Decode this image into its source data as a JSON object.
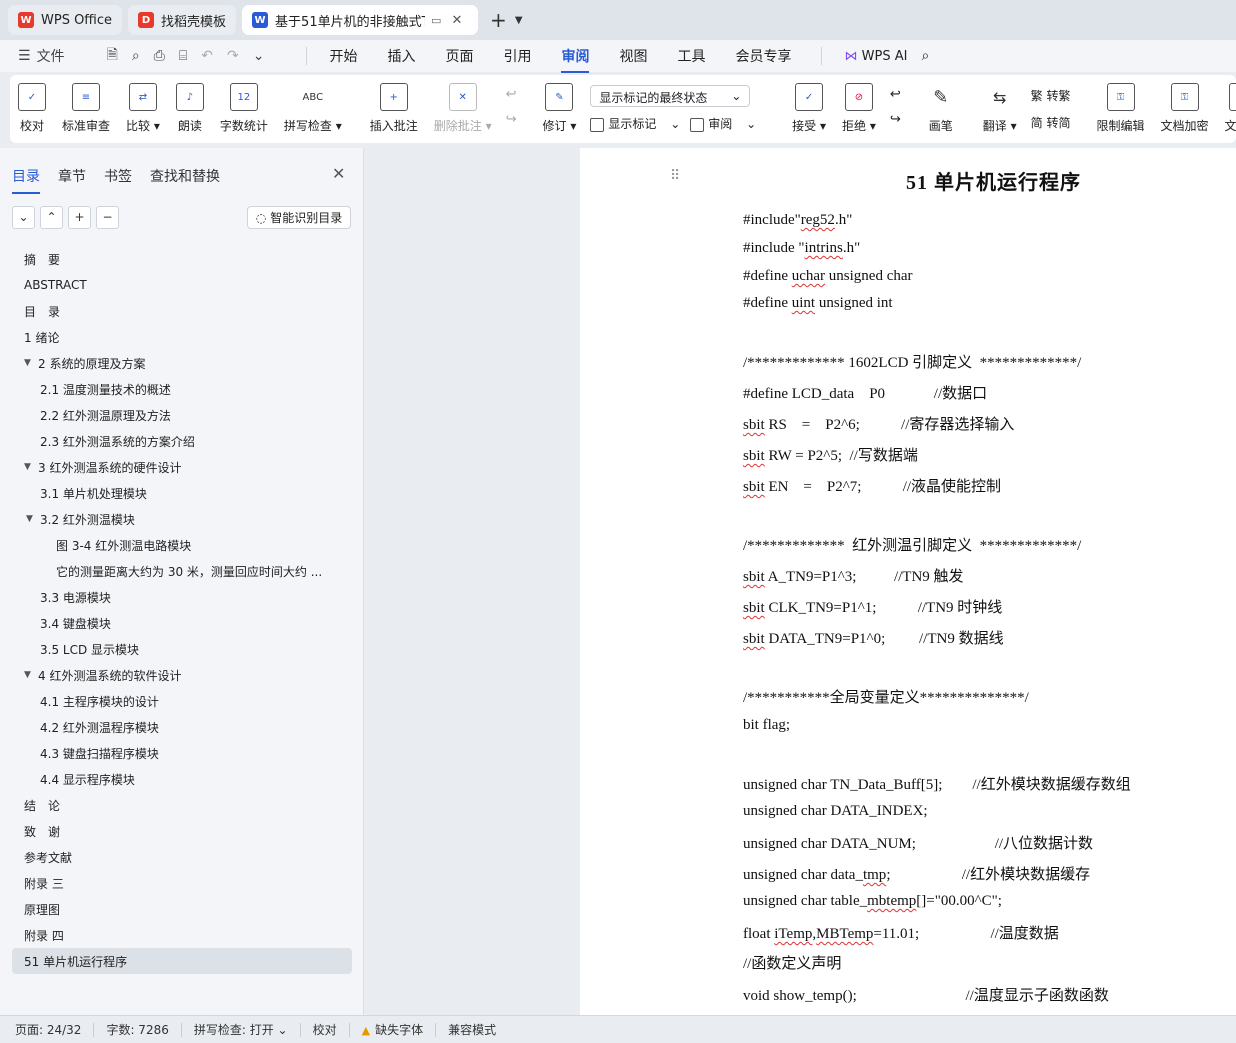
{
  "tabs": [
    {
      "label": "WPS Office",
      "logo": "W",
      "color": "#e8392d"
    },
    {
      "label": "找稻壳模板",
      "logo": "D",
      "color": "#e8392d"
    },
    {
      "label": "基于51单片机的非接触式TN9",
      "logo": "W",
      "color": "#2a5bd7"
    }
  ],
  "menu": {
    "file": "文件",
    "items": [
      "开始",
      "插入",
      "页面",
      "引用",
      "审阅",
      "视图",
      "工具",
      "会员专享"
    ],
    "active": "审阅",
    "wps_ai": "WPS AI"
  },
  "ribbon": {
    "proofread": "校对",
    "standard_review": "标准审查",
    "compare": "比较",
    "read_aloud": "朗读",
    "word_count": "字数统计",
    "spell_check": "拼写检查",
    "insert_comment": "插入批注",
    "delete_comment": "删除批注",
    "track_changes": "修订",
    "markup_dropdown": "显示标记的最终状态",
    "show_markup": "显示标记",
    "review": "审阅",
    "accept": "接受",
    "reject": "拒绝",
    "pen": "画笔",
    "translate": "翻译",
    "to_traditional": "转繁",
    "to_simplified": "转简",
    "restrict_edit": "限制编辑",
    "encrypt": "文档加密",
    "doc_more": "文档定"
  },
  "nav": {
    "tabs": [
      "目录",
      "章节",
      "书签",
      "查找和替换"
    ],
    "smart_toc": "智能识别目录",
    "toc": [
      {
        "label": "摘　要",
        "level": 1
      },
      {
        "label": "ABSTRACT",
        "level": 1
      },
      {
        "label": "目　录",
        "level": 1
      },
      {
        "label": "1 绪论",
        "level": 1
      },
      {
        "label": "2  系统的原理及方案",
        "level": 1,
        "expanded": true
      },
      {
        "label": "2.1 温度测量技术的概述",
        "level": 2
      },
      {
        "label": "2.2  红外测温原理及方法",
        "level": 2
      },
      {
        "label": "2.3  红外测温系统的方案介绍",
        "level": 2
      },
      {
        "label": "3  红外测温系统的硬件设计",
        "level": 1,
        "expanded": true
      },
      {
        "label": "3.1  单片机处理模块",
        "level": 2
      },
      {
        "label": "3.2  红外测温模块",
        "level": 2,
        "expanded": true
      },
      {
        "label": "图 3-4  红外测温电路模块",
        "level": 3
      },
      {
        "label": "它的测量距离大约为 30 米，测量回应时间大约 ...",
        "level": 3
      },
      {
        "label": "3.3  电源模块",
        "level": 2
      },
      {
        "label": "3.4  键盘模块",
        "level": 2
      },
      {
        "label": "3.5 LCD 显示模块",
        "level": 2
      },
      {
        "label": "4  红外测温系统的软件设计",
        "level": 1,
        "expanded": true
      },
      {
        "label": "4.1  主程序模块的设计",
        "level": 2
      },
      {
        "label": "4.2  红外测温程序模块",
        "level": 2
      },
      {
        "label": "4.3  键盘扫描程序模块",
        "level": 2
      },
      {
        "label": "4.4  显示程序模块",
        "level": 2
      },
      {
        "label": "结　论",
        "level": 1
      },
      {
        "label": "致　谢",
        "level": 1
      },
      {
        "label": "参考文献",
        "level": 1
      },
      {
        "label": "附录 三",
        "level": 1
      },
      {
        "label": "原理图",
        "level": 1
      },
      {
        "label": "附录 四",
        "level": 1
      },
      {
        "label": "51 单片机运行程序",
        "level": 1,
        "selected": true
      }
    ]
  },
  "document": {
    "title": "51 单片机运行程序",
    "lines": [
      "#include\"reg52.h\"",
      "#include \"intrins.h\"",
      "#define uchar unsigned char",
      "#define uint unsigned int",
      "/************* 1602LCD 引脚定义  *************/",
      "#define LCD_data    P0             //数据口",
      "sbit RS    =    P2^6;           //寄存器选择输入",
      "sbit RW = P2^5;  //写数据端",
      "sbit EN    =    P2^7;           //液晶使能控制",
      "/*************  红外测温引脚定义  *************/",
      "sbit A_TN9=P1^3;          //TN9 触发",
      "sbit CLK_TN9=P1^1;           //TN9 时钟线",
      "sbit DATA_TN9=P1^0;         //TN9 数据线",
      "/***********全局变量定义**************/",
      "bit flag;",
      "unsigned char TN_Data_Buff[5];        //红外模块数据缓存数组",
      "unsigned char DATA_INDEX;",
      "unsigned char DATA_NUM;                     //八位数据计数",
      "unsigned char data_tmp;                   //红外模块数据缓存",
      "unsigned char table_mbtemp[]=\"00.00^C\";",
      "float iTemp,MBTemp=11.01;                   //温度数据",
      "//函数定义声明",
      "void show_temp();                             //温度显示子函数函数"
    ]
  },
  "status": {
    "page": "页面: 24/32",
    "words": "字数: 7286",
    "spell": "拼写检查: 打开",
    "proof": "校对",
    "missing_font": "缺失字体",
    "compat": "兼容模式"
  }
}
